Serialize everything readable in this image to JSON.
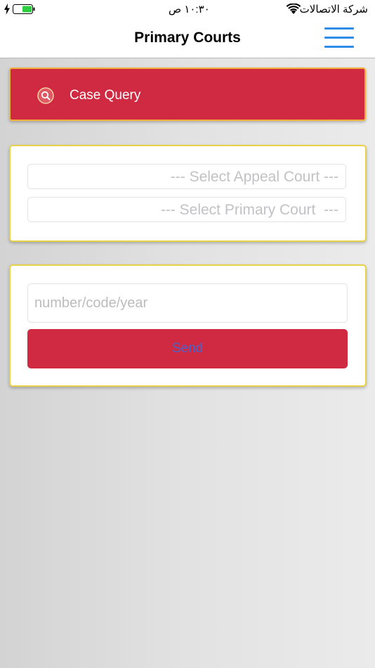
{
  "status_bar": {
    "carrier": "شركة الاتصالات",
    "time": "١٠:٣٠ ص",
    "battery_color": "#2ecc40"
  },
  "nav": {
    "title": "Primary Courts",
    "menu_icon": "hamburger-menu-icon",
    "accent_color": "#2f8ce6"
  },
  "case_query": {
    "icon": "search-icon",
    "label": "Case Query",
    "background_color": "#cf2a42",
    "border_color": "#f1b23b"
  },
  "court_selection": {
    "appeal_court_placeholder": "--- Select Appeal Court ---",
    "primary_court_placeholder": "--- Select Primary Court  ---"
  },
  "case_search": {
    "input_placeholder": "number/code/year",
    "input_value": "",
    "send_label": "Send"
  }
}
